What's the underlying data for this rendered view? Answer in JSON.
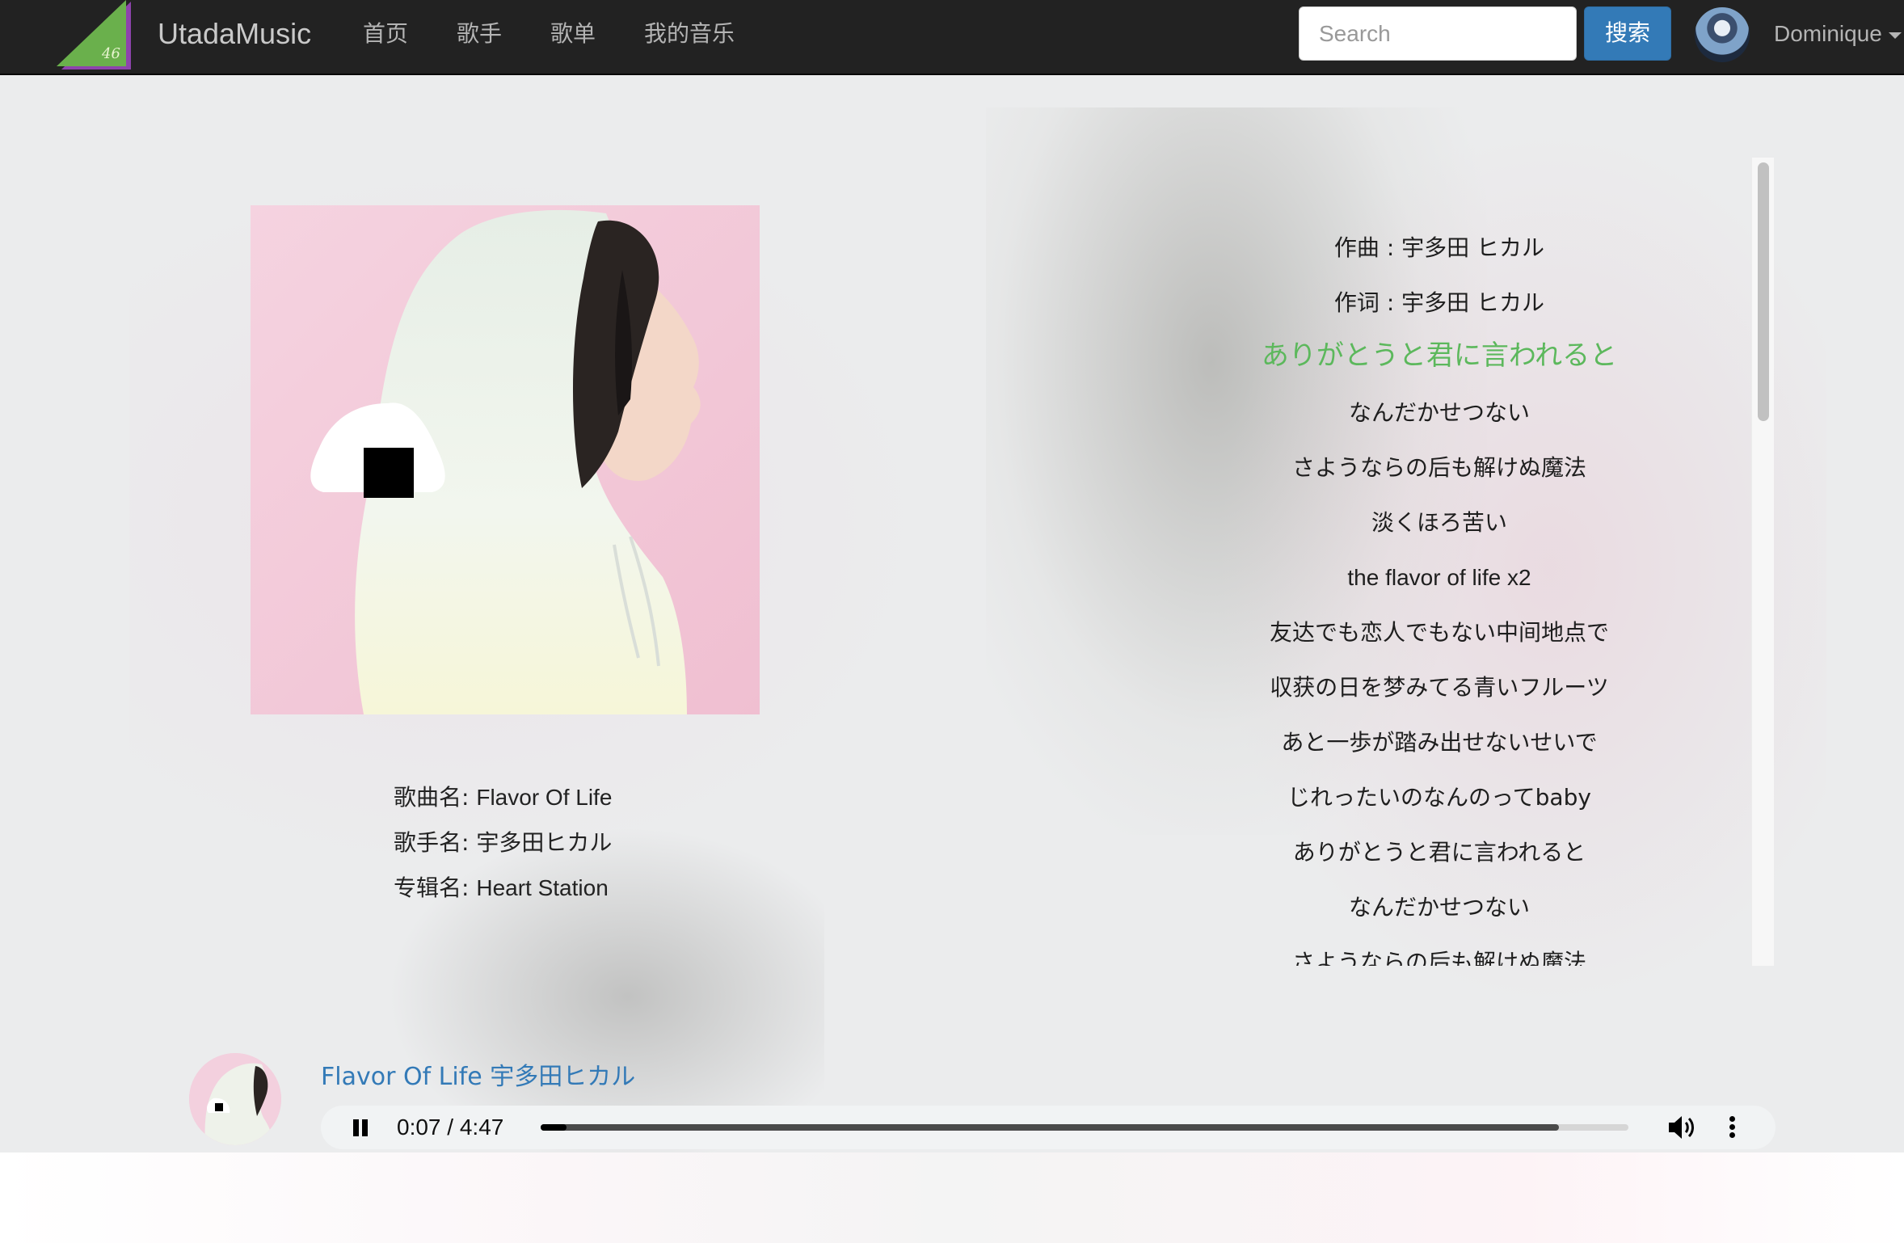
{
  "navbar": {
    "brand": "UtadaMusic",
    "logo_text": "46",
    "links": [
      {
        "label": "首页"
      },
      {
        "label": "歌手"
      },
      {
        "label": "歌单"
      },
      {
        "label": "我的音乐"
      }
    ],
    "search_placeholder": "Search",
    "search_button": "搜索",
    "username": "Dominique"
  },
  "song": {
    "title_label": "歌曲名:",
    "title": "Flavor Of Life",
    "artist_label": "歌手名:",
    "artist": "宇多田ヒカル",
    "album_label": "专辑名:",
    "album": "Heart Station"
  },
  "lyrics": {
    "current_index": 2,
    "lines": [
      "作曲 : 宇多田 ヒカル",
      "作词 : 宇多田 ヒカル",
      "ありがとうと君に言われると",
      "なんだかせつない",
      "さようならの后も解けぬ魔法",
      "淡くほろ苦い",
      "the flavor of life x2",
      "友达でも恋人でもない中间地点で",
      "収获の日を梦みてる青いフルーツ",
      "あと一歩が踏み出せないせいで",
      "じれったいのなんのってbaby",
      "ありがとうと君に言われると",
      "なんだかせつない",
      "さようならの后も解けぬ魔法"
    ]
  },
  "player": {
    "now_playing_title": "Flavor Of Life",
    "now_playing_artist": "宇多田ヒカル",
    "current_time": "0:07",
    "duration": "4:47",
    "time_separator": "/",
    "played_fraction": 0.024,
    "buffered_fraction": 0.936,
    "state": "playing"
  },
  "colors": {
    "navbar_bg": "#222222",
    "accent_blue": "#337ab7",
    "current_lyric_green": "#5cb85c",
    "logo_green": "#6ab04c",
    "logo_purple": "#8e44ad"
  },
  "icons": {
    "logo": "green-triangle-logo",
    "pause": "pause-icon",
    "volume": "volume-icon",
    "more": "more-vertical-icon",
    "caret": "caret-down-icon"
  }
}
